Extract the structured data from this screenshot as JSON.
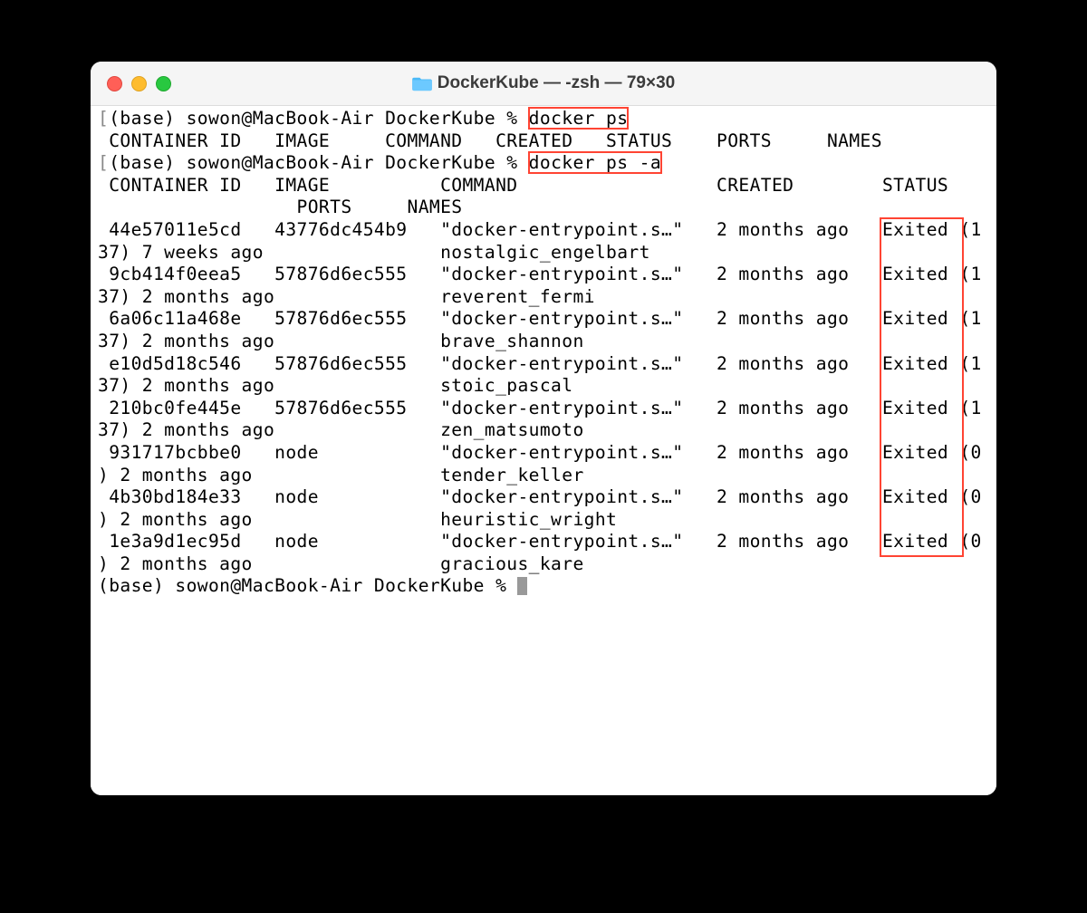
{
  "window": {
    "title": "DockerKube — -zsh — 79×30"
  },
  "prompt": "(base) sowon@MacBook-Air DockerKube % ",
  "commands": {
    "cmd1": "docker ps",
    "cmd2": "docker ps -a"
  },
  "headers_short": " CONTAINER ID   IMAGE     COMMAND   CREATED   STATUS    PORTS     NAMES",
  "headers_a_line1": " CONTAINER ID   IMAGE          COMMAND                  CREATED        STATUS ",
  "headers_a_line2": "                  PORTS     NAMES",
  "rows": [
    {
      "l1a": " 44e57011e5cd   43776dc454b9   \"docker-entrypoint.s…\"   2 months ago   ",
      "status": "Exited ",
      "l1b": "(1",
      "l2": "37) 7 weeks ago                nostalgic_engelbart"
    },
    {
      "l1a": " 9cb414f0eea5   57876d6ec555   \"docker-entrypoint.s…\"   2 months ago   ",
      "status": "Exited ",
      "l1b": "(1",
      "l2": "37) 2 months ago               reverent_fermi"
    },
    {
      "l1a": " 6a06c11a468e   57876d6ec555   \"docker-entrypoint.s…\"   2 months ago   ",
      "status": "Exited ",
      "l1b": "(1",
      "l2": "37) 2 months ago               brave_shannon"
    },
    {
      "l1a": " e10d5d18c546   57876d6ec555   \"docker-entrypoint.s…\"   2 months ago   ",
      "status": "Exited ",
      "l1b": "(1",
      "l2": "37) 2 months ago               stoic_pascal"
    },
    {
      "l1a": " 210bc0fe445e   57876d6ec555   \"docker-entrypoint.s…\"   2 months ago   ",
      "status": "Exited ",
      "l1b": "(1",
      "l2": "37) 2 months ago               zen_matsumoto"
    },
    {
      "l1a": " 931717bcbbe0   node           \"docker-entrypoint.s…\"   2 months ago   ",
      "status": "Exited ",
      "l1b": "(0",
      "l2": ") 2 months ago                 tender_keller"
    },
    {
      "l1a": " 4b30bd184e33   node           \"docker-entrypoint.s…\"   2 months ago   ",
      "status": "Exited ",
      "l1b": "(0",
      "l2": ") 2 months ago                 heuristic_wright"
    },
    {
      "l1a": " 1e3a9d1ec95d   node           \"docker-entrypoint.s…\"   2 months ago   ",
      "status": "Exited ",
      "l1b": "(0",
      "l2": ") 2 months ago                 gracious_kare"
    }
  ],
  "bracket_left": "[",
  "bracket_right": "]"
}
